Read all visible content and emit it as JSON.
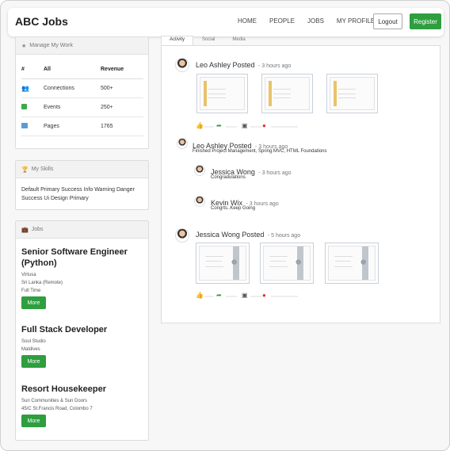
{
  "brand": "ABC Jobs",
  "nav": {
    "links": [
      "HOME",
      "PEOPLE",
      "JOBS",
      "MY PROFILE"
    ],
    "logout_label": "Logout",
    "register_label": "Register"
  },
  "manage_work": {
    "title": "Manage My Work",
    "headers": [
      "#",
      "All",
      "Revenue"
    ],
    "rows": [
      {
        "label": "Connections",
        "value": "500+",
        "icon": "people-icon"
      },
      {
        "label": "Events",
        "value": "250+",
        "icon": "calendar-icon"
      },
      {
        "label": "Pages",
        "value": "1765",
        "icon": "pages-icon"
      }
    ]
  },
  "skills": {
    "title": "My Skills",
    "text": "Default Primary Success Info Warning Danger Success Ui Design Primary"
  },
  "jobs": {
    "title": "Jobs",
    "more_label": "More",
    "items": [
      {
        "title": "Senior Software Engineer (Python)",
        "company": "Virtusa",
        "location": "Sri Lanka (Remote)",
        "type": "Full Time"
      },
      {
        "title": "Full Stack Developer",
        "company": "Soul Studio",
        "location": "Maldives",
        "type": ""
      },
      {
        "title": "Resort Housekeeper",
        "company": "Sun Communities & Sun Doors",
        "location": "45/C St.Francis Road, Colombo 7",
        "type": ""
      }
    ]
  },
  "tabs": [
    "Activity",
    "Social",
    "Media"
  ],
  "feed": [
    {
      "author": "Leo Ashley Posted",
      "time": "- 3 hours ago"
    },
    {
      "author": "Leo Ashley Posted",
      "time": "- 3 hours ago",
      "text": "Finished Project Management, Spring MVC, HTML Foundations",
      "comments": [
        {
          "author": "Jessica Wong",
          "time": "- 3 hours ago",
          "text": "Congradulations"
        },
        {
          "author": "Kevin Wix",
          "time": "- 3 hours ago",
          "text": "Congrts..Keep Going"
        }
      ]
    },
    {
      "author": "Jessica Wong Posted",
      "time": "- 5 hours ago"
    }
  ],
  "icons": {
    "like": "thumbs-up-icon",
    "share": "share-icon",
    "save": "save-icon",
    "comment": "comment-icon"
  },
  "colors": {
    "accent": "#2e9e3f",
    "like": "#2f6fd6",
    "comment": "#d33"
  }
}
